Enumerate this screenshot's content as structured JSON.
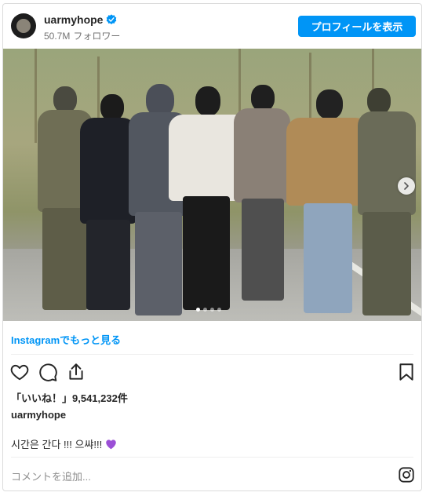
{
  "header": {
    "username": "uarmyhope",
    "followers_count": "50.7M",
    "followers_label": "フォロワー",
    "profile_button": "プロフィールを表示"
  },
  "post": {
    "view_more_link": "Instagramでもっと見る",
    "likes_text": "「いいね！」9,541,232件",
    "caption_user": "uarmyhope",
    "caption_text": "시간은 간다 !!! 으쌰!!!",
    "caption_emoji": "purple-heart-icon",
    "carousel_dots": 4,
    "carousel_active_index": 0
  },
  "comment": {
    "placeholder": "コメントを追加..."
  },
  "icons": {
    "like": "heart-icon",
    "comment": "comment-icon",
    "share": "share-icon",
    "save": "bookmark-icon",
    "brand": "instagram-icon",
    "next": "chevron-right-icon",
    "verified": "verified-badge-icon"
  },
  "colors": {
    "accent": "#0095f6",
    "text": "#262626",
    "muted": "#737373",
    "heart_emoji": "#9b4fd6"
  }
}
